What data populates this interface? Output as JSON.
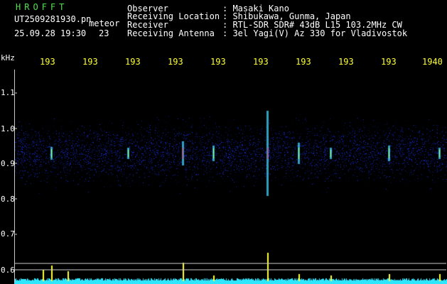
{
  "header": {
    "program_name": "HROFFT",
    "file_name": "UT2509281930.pn",
    "file_tag": "meteor",
    "date_time": "25.09.28 19:30",
    "number": "23",
    "observer_label": "Observer",
    "observer_value": ": Masaki Kano",
    "location_label": "Receiving Location",
    "location_value": ": Shibukawa, Gunma, Japan",
    "receiver_label": "Receiver",
    "receiver_value": ": RTL-SDR SDR# 43dB L15 103.2MHz CW",
    "antenna_label": "Receiving Antenna",
    "antenna_value": ": 3el Yagi(V) Az 330 for Vladivostok"
  },
  "axis": {
    "y_unit": "kHz",
    "y_ticks": [
      "1.1",
      "1.0",
      "0.9",
      "0.8",
      "0.7",
      "0.6"
    ],
    "x_ticks": [
      "193",
      "193",
      "193",
      "193",
      "193",
      "193",
      "193",
      "193",
      "193",
      "1940"
    ]
  },
  "colors": {
    "background": "#000000",
    "title": "#4fe04f",
    "x_tick_labels": "#ffff33",
    "noise": "#1a2fc0",
    "echo_core": "#ff2a6a",
    "echo_halo": "#3fd6ff",
    "level_trace": "#2fe6ff",
    "level_peaks": "#ffff33"
  }
}
